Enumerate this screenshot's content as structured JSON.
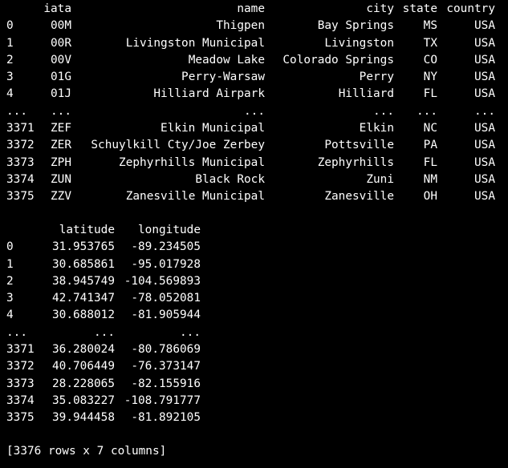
{
  "table1": {
    "headers": [
      "iata",
      "name",
      "city",
      "state",
      "country"
    ],
    "rows": [
      {
        "index": "0",
        "iata": "00M",
        "name": "Thigpen",
        "city": "Bay Springs",
        "state": "MS",
        "country": "USA"
      },
      {
        "index": "1",
        "iata": "00R",
        "name": "Livingston Municipal",
        "city": "Livingston",
        "state": "TX",
        "country": "USA"
      },
      {
        "index": "2",
        "iata": "00V",
        "name": "Meadow Lake",
        "city": "Colorado Springs",
        "state": "CO",
        "country": "USA"
      },
      {
        "index": "3",
        "iata": "01G",
        "name": "Perry-Warsaw",
        "city": "Perry",
        "state": "NY",
        "country": "USA"
      },
      {
        "index": "4",
        "iata": "01J",
        "name": "Hilliard Airpark",
        "city": "Hilliard",
        "state": "FL",
        "country": "USA"
      },
      {
        "index": "...",
        "iata": "...",
        "name": "...",
        "city": "...",
        "state": "...",
        "country": "..."
      },
      {
        "index": "3371",
        "iata": "ZEF",
        "name": "Elkin Municipal",
        "city": "Elkin",
        "state": "NC",
        "country": "USA"
      },
      {
        "index": "3372",
        "iata": "ZER",
        "name": "Schuylkill Cty/Joe Zerbey",
        "city": "Pottsville",
        "state": "PA",
        "country": "USA"
      },
      {
        "index": "3373",
        "iata": "ZPH",
        "name": "Zephyrhills Municipal",
        "city": "Zephyrhills",
        "state": "FL",
        "country": "USA"
      },
      {
        "index": "3374",
        "iata": "ZUN",
        "name": "Black Rock",
        "city": "Zuni",
        "state": "NM",
        "country": "USA"
      },
      {
        "index": "3375",
        "iata": "ZZV",
        "name": "Zanesville Municipal",
        "city": "Zanesville",
        "state": "OH",
        "country": "USA"
      }
    ]
  },
  "table2": {
    "headers": [
      "latitude",
      "longitude"
    ],
    "rows": [
      {
        "index": "0",
        "latitude": "31.953765",
        "longitude": "-89.234505"
      },
      {
        "index": "1",
        "latitude": "30.685861",
        "longitude": "-95.017928"
      },
      {
        "index": "2",
        "latitude": "38.945749",
        "longitude": "-104.569893"
      },
      {
        "index": "3",
        "latitude": "42.741347",
        "longitude": "-78.052081"
      },
      {
        "index": "4",
        "latitude": "30.688012",
        "longitude": "-81.905944"
      },
      {
        "index": "...",
        "latitude": "...",
        "longitude": "..."
      },
      {
        "index": "3371",
        "latitude": "36.280024",
        "longitude": "-80.786069"
      },
      {
        "index": "3372",
        "latitude": "40.706449",
        "longitude": "-76.373147"
      },
      {
        "index": "3373",
        "latitude": "28.228065",
        "longitude": "-82.155916"
      },
      {
        "index": "3374",
        "latitude": "35.083227",
        "longitude": "-108.791777"
      },
      {
        "index": "3375",
        "latitude": "39.944458",
        "longitude": "-81.892105"
      }
    ]
  },
  "footer": "[3376 rows x 7 columns]",
  "colors": {
    "background": "#000000",
    "text": "#ffffff"
  }
}
